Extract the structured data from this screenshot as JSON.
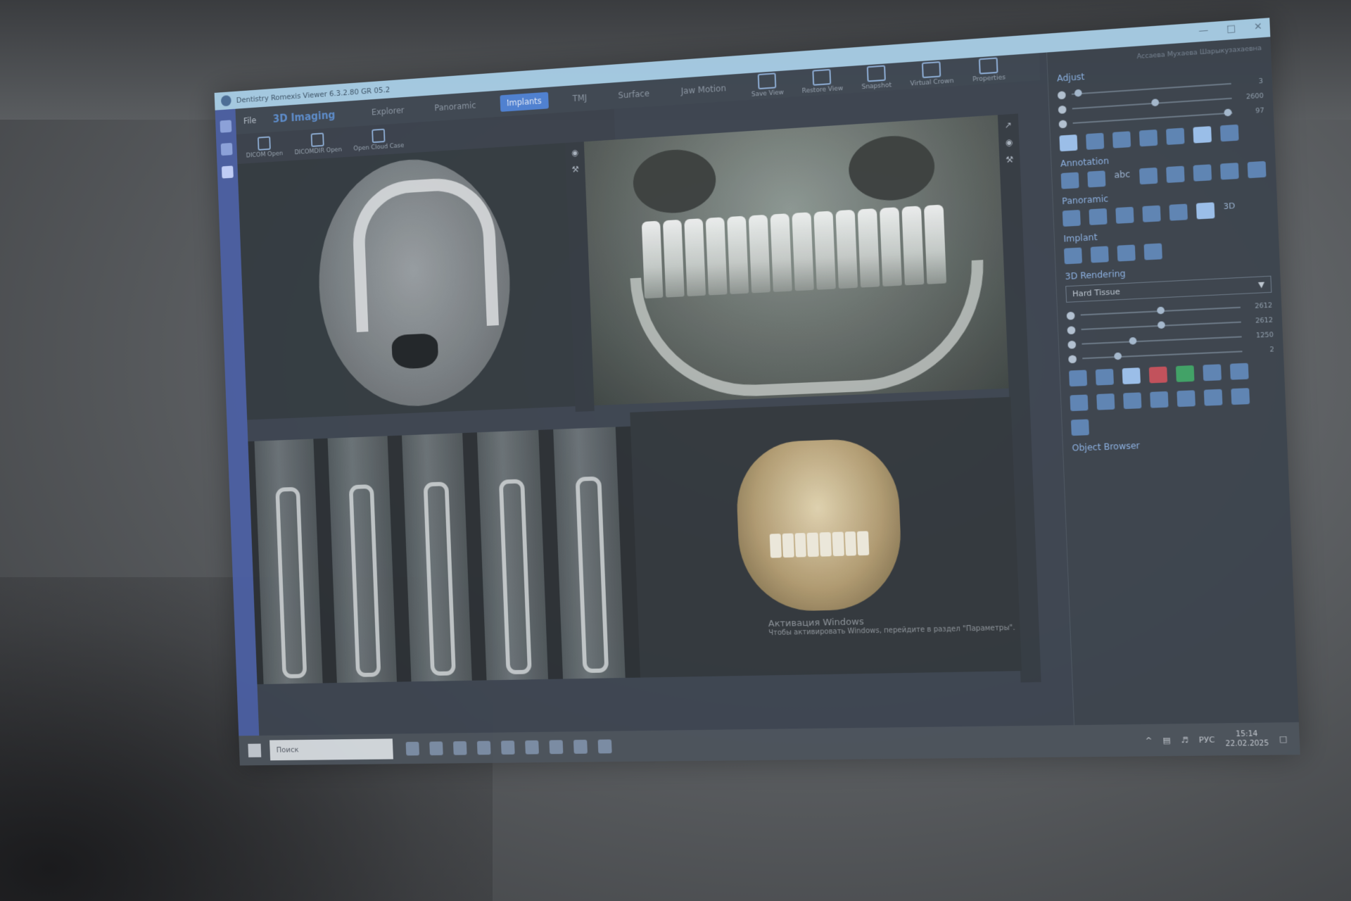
{
  "window": {
    "title": "Dentistry Romexis Viewer 6.3.2.80 GR 05.2"
  },
  "menu": {
    "file": "File",
    "brand": "3D Imaging",
    "tabs": [
      "Explorer",
      "Panoramic",
      "Implants",
      "TMJ",
      "Surface",
      "Jaw Motion"
    ],
    "active_tab": "Implants",
    "tools": [
      "Save View",
      "Restore View",
      "Snapshot",
      "Virtual Crown",
      "Properties"
    ]
  },
  "subtools": [
    "DICOM Open",
    "DICOMDIR Open",
    "Open Cloud Case"
  ],
  "right_panel": {
    "user": "Ассаева Мухаева Шарыкузахаевна",
    "adjust": {
      "title": "Adjust",
      "values": [
        "3",
        "2600",
        "97"
      ]
    },
    "annotation": {
      "title": "Annotation",
      "abc": "abc"
    },
    "panoramic": {
      "title": "Panoramic",
      "label3d": "3D"
    },
    "implant": {
      "title": "Implant"
    },
    "rendering": {
      "title": "3D Rendering",
      "preset": "Hard Tissue",
      "values": [
        "2612",
        "2612",
        "1250",
        "2"
      ]
    },
    "object_browser": {
      "title": "Object Browser"
    }
  },
  "activation": {
    "line1": "Активация Windows",
    "line2": "Чтобы активировать Windows, перейдите в раздел \"Параметры\"."
  },
  "taskbar": {
    "search_placeholder": "Поиск",
    "lang": "РУС",
    "time": "15:14",
    "date": "22.02.2025"
  }
}
